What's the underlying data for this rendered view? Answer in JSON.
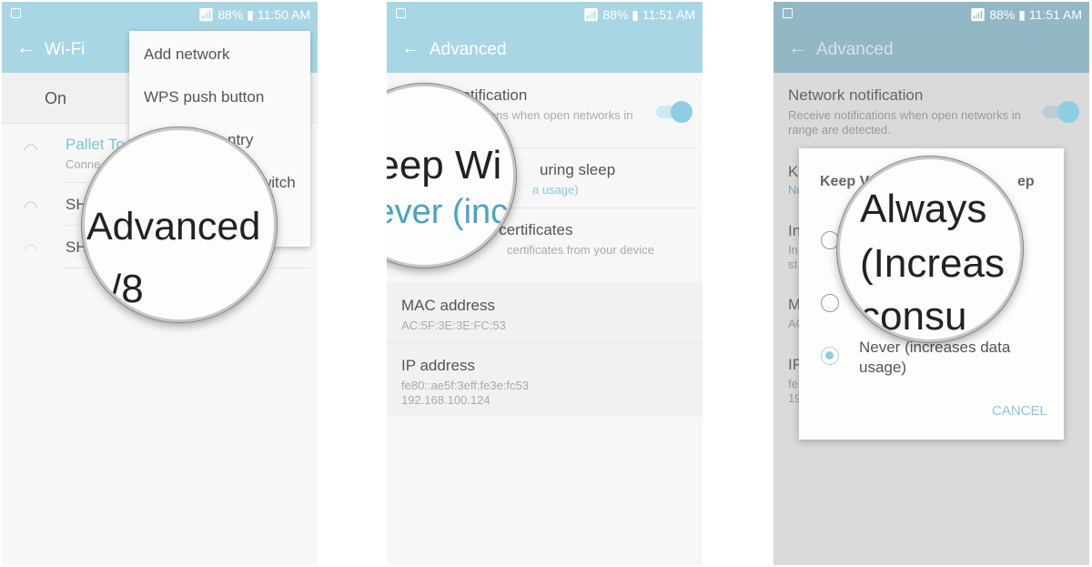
{
  "status": {
    "battery": "88%",
    "times": [
      "11:50 AM",
      "11:51 AM",
      "11:51 AM"
    ]
  },
  "panel1": {
    "title": "Wi-Fi",
    "on_label": "On",
    "networks": [
      {
        "name": "Pallet To",
        "sub": "Conne"
      },
      {
        "name": "SH"
      },
      {
        "name": "SH"
      }
    ],
    "menu": [
      "Add network",
      "WPS push button",
      "ntry",
      "witch"
    ],
    "magnified": "Advanced",
    "below": "/8"
  },
  "panel2": {
    "title": "Advanced",
    "rows": [
      {
        "title": "notification",
        "sub": "ions when open networks in"
      },
      {
        "title": "uring sleep",
        "sub": "a usage)"
      },
      {
        "title": "k certificates",
        "sub": "certificates from your device"
      }
    ],
    "info": [
      {
        "title": "MAC address",
        "sub": "AC:5F:3E:3E:FC:53"
      },
      {
        "title": "IP address",
        "sub": "fe80::ae5f:3eff:fe3e:fc53",
        "sub2": "192.168.100.124"
      }
    ],
    "magnified": {
      "line1": "Keep Wi",
      "line2": "Never (incr"
    },
    "toggle_on": true
  },
  "panel3": {
    "title": "Advanced",
    "bg_rows": [
      {
        "title": "Network notification",
        "sub": "Receive notifications when open networks in",
        "sub2": "range are detected."
      },
      {
        "title": "K",
        "sub": "Ne"
      },
      {
        "title": "In",
        "sub": "In",
        "sub2": "st"
      },
      {
        "title": "M",
        "sub": "AC"
      },
      {
        "title": "IP",
        "sub": "fe",
        "sub2": "19"
      }
    ],
    "dialog": {
      "title_left": "Keep V",
      "title_right": "ep",
      "option_never": "Never (increases data",
      "option_never2": "usage)",
      "cancel": "CANCEL",
      "selected": "Never"
    },
    "magnified": {
      "line1": "Always",
      "line2": "(Increas",
      "line3": "consu"
    }
  },
  "colors": {
    "accent": "#a8d6e5",
    "link": "#4aa3c2"
  }
}
